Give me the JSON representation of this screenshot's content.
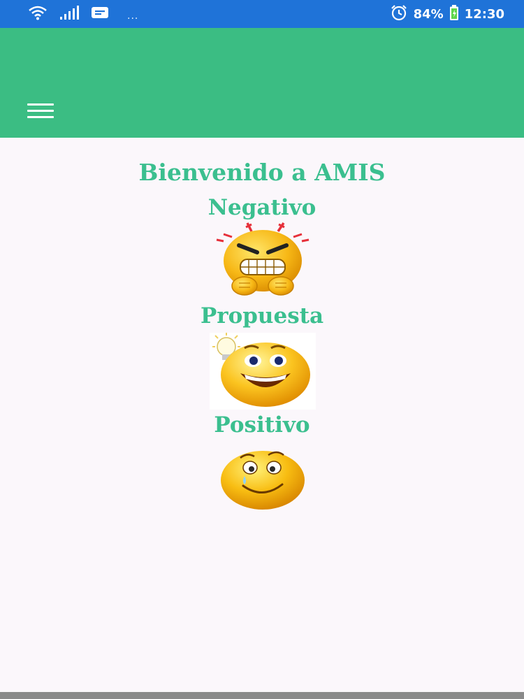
{
  "status_bar": {
    "overflow_dots": "...",
    "battery": "84%",
    "time": "12:30",
    "icons": [
      "wifi-icon",
      "signal-icon",
      "message-icon",
      "alarm-icon",
      "battery-icon"
    ]
  },
  "app_bar": {
    "color": "#3bbd83",
    "menu_icon": "hamburger-menu-icon"
  },
  "main": {
    "welcome": "Bienvenido a AMIS",
    "options": [
      {
        "label": "Negativo",
        "emoji": "angry-face-icon"
      },
      {
        "label": "Propuesta",
        "emoji": "idea-face-icon"
      },
      {
        "label": "Positivo",
        "emoji": "happy-face-icon"
      }
    ],
    "text_color": "#3bbf8f"
  }
}
